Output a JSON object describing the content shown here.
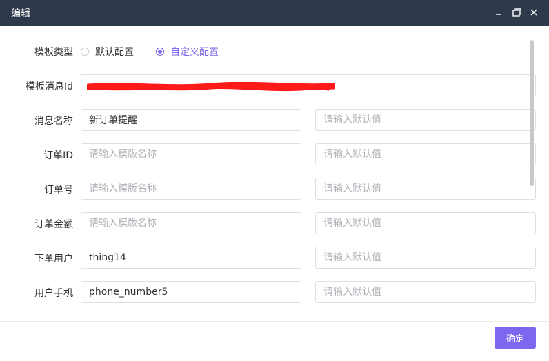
{
  "window": {
    "title": "编辑",
    "controls": [
      "minimize-icon",
      "maximize-icon",
      "close-icon"
    ]
  },
  "form": {
    "template_type": {
      "label": "模板类型",
      "options": [
        {
          "label": "默认配置",
          "checked": false
        },
        {
          "label": "自定义配置",
          "checked": true
        }
      ]
    },
    "template_message_id": {
      "label": "模板消息Id",
      "value": ""
    },
    "fields": [
      {
        "label": "消息名称",
        "value": "新订单提醒",
        "placeholder": "请输入模版名称",
        "default_placeholder": "请输入默认值"
      },
      {
        "label": "订单ID",
        "value": "",
        "placeholder": "请输入模版名称",
        "default_placeholder": "请输入默认值"
      },
      {
        "label": "订单号",
        "value": "",
        "placeholder": "请输入模版名称",
        "default_placeholder": "请输入默认值"
      },
      {
        "label": "订单金额",
        "value": "",
        "placeholder": "请输入模版名称",
        "default_placeholder": "请输入默认值"
      },
      {
        "label": "下单用户",
        "value": "thing14",
        "placeholder": "请输入模版名称",
        "default_placeholder": "请输入默认值"
      },
      {
        "label": "用户手机",
        "value": "phone_number5",
        "placeholder": "请输入模版名称",
        "default_placeholder": "请输入默认值"
      }
    ]
  },
  "footer": {
    "confirm_label": "确定"
  },
  "colors": {
    "titlebar": "#2e3a4b",
    "accent": "#7b68ee",
    "redaction": "#ff1a1a"
  }
}
